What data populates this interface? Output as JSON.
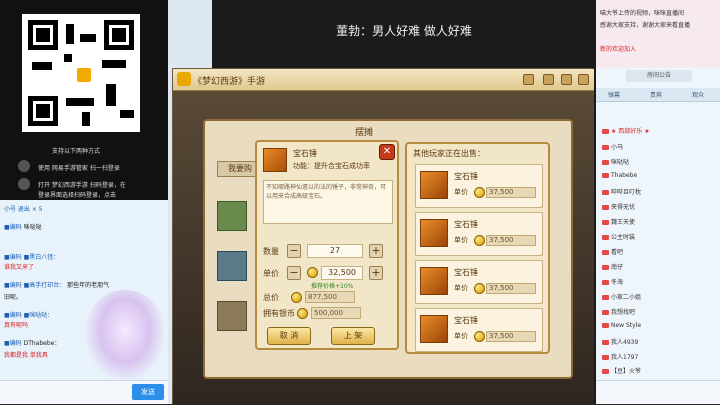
{
  "subtitle": "董勃：男人好难 做人好难",
  "left": {
    "qr_caption": "支持以下两种方式",
    "line1": "使用 网易手游管家 扫一扫登录",
    "line2": "打开 梦幻西游手游 扫码登录，在",
    "line3": "登录界面选择扫码登录，点击",
    "toolbar": "小号   退出        × 5",
    "chat": [
      {
        "user": "■编码",
        "text": "咪哒哒"
      },
      {
        "user": "■编码 ■黑白八怪：",
        "text": ""
      },
      {
        "user": "",
        "text": "谁我又来了"
      },
      {
        "user": "■编码 ■高手打印台：",
        "text": "那些年的老朋气"
      },
      {
        "user": "",
        "text": "旧呢。"
      },
      {
        "user": "■编码 ■咪哒哒：",
        "text": ""
      },
      {
        "user": "",
        "text": "真有呢吗"
      },
      {
        "user": "■编码",
        "text": "DThabebe："
      },
      {
        "user": "",
        "text": "我都是我  单我具"
      }
    ],
    "send_label": "发送"
  },
  "game": {
    "window_title": "《梦幻西游》手游",
    "bg_title": "摆摊",
    "bg_button": "我要购",
    "popup": {
      "item_name": "宝石锤",
      "function": "功能：提升合宝石成功率",
      "desc": "不知哪路神仙遗以的法的锤子，非常神奇，可以用来合成高级宝石。",
      "qty_label": "数量",
      "qty": "27",
      "price_label": "单价",
      "price": "32,500",
      "recommend": "推荐价格+10%",
      "total_label": "总价",
      "total": "877,500",
      "owned_label": "拥有银币",
      "owned": "500,000",
      "cancel": "取 消",
      "confirm": "上 架"
    },
    "others": {
      "title": "其他玩家正在出售：",
      "items": [
        {
          "name": "宝石锤",
          "label": "单价",
          "price": "37,500"
        },
        {
          "name": "宝石锤",
          "label": "单价",
          "price": "37,500"
        },
        {
          "name": "宝石锤",
          "label": "单价",
          "price": "37,500"
        },
        {
          "name": "宝石锤",
          "label": "单价",
          "price": "37,500"
        }
      ]
    }
  },
  "right": {
    "top_lines": [
      "喵大爷上传的视频，咪咪直播间",
      "感谢大家支持，谢谢大家来看直播",
      "",
      "新的欢迎加入"
    ],
    "notice": "房间公告",
    "tabs": [
      "弹幕",
      "贵宾",
      "观众"
    ],
    "users": [
      "★ 西部好乐 ★",
      "小马",
      "咪哒哒",
      "Thabebe",
      "哔哔且叮枕",
      "夹得无忧",
      "魏王天使",
      "公主时装",
      "看吧",
      "南仔",
      "冬海",
      "小家二小姐",
      "我想找吧",
      "New Style",
      "我人4939",
      "我人1797",
      "【豆】火爷"
    ]
  }
}
